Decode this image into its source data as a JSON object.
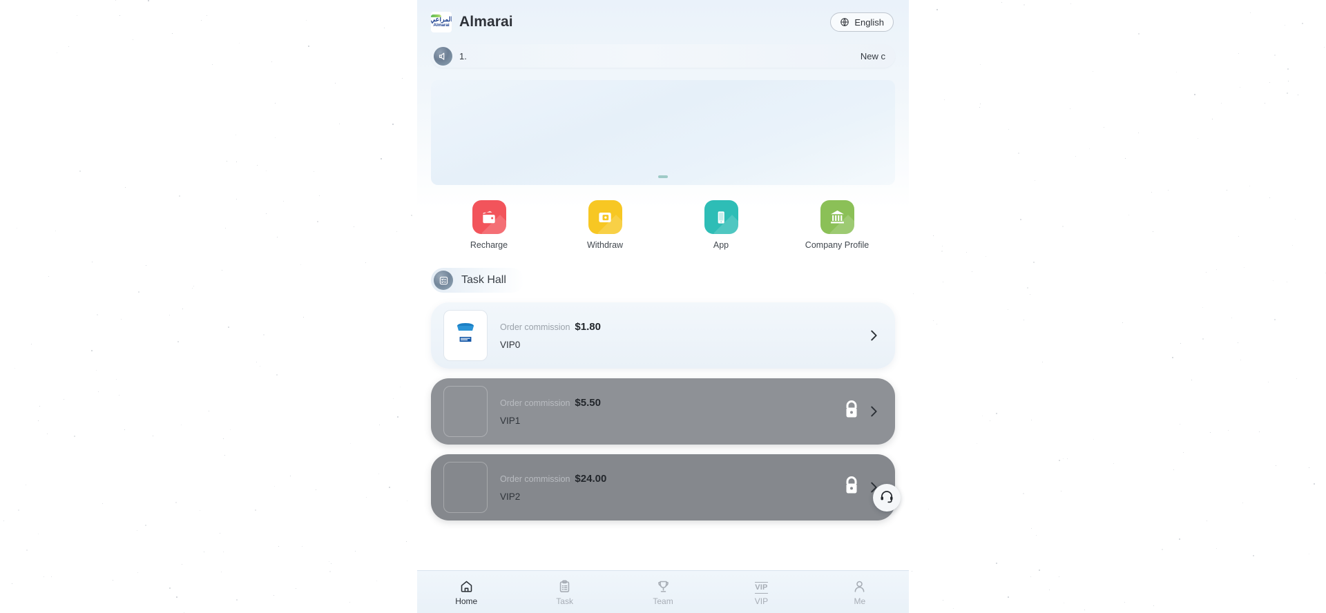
{
  "header": {
    "brand_name": "Almarai",
    "logo_arabic": "المراعي",
    "logo_latin": "Almarai",
    "language_label": "English",
    "language_icon": "globe-icon"
  },
  "notice": {
    "icon": "megaphone-icon",
    "index": "1.",
    "text": "New c"
  },
  "banner": {
    "dots": 1
  },
  "quick_actions": [
    {
      "label": "Recharge",
      "icon": "wallet-icon",
      "color": "#f2545b"
    },
    {
      "label": "Withdraw",
      "icon": "withdraw-card-icon",
      "color": "#f7c723"
    },
    {
      "label": "App",
      "icon": "mobile-app-icon",
      "color": "#2ebdb6"
    },
    {
      "label": "Company Profile",
      "icon": "bank-building-icon",
      "color": "#8bc057"
    }
  ],
  "task_hall": {
    "icon": "checklist-icon",
    "title": "Task Hall"
  },
  "vip_cards": [
    {
      "level": "VIP0",
      "commission_label": "Order commission",
      "commission_value": "$1.80",
      "locked": false,
      "thumb": "yogurt-tub-product-image",
      "chevron": "chevron-right-icon"
    },
    {
      "level": "VIP1",
      "commission_label": "Order commission",
      "commission_value": "$5.50",
      "locked": true,
      "lock_icon": "lock-icon",
      "chevron": "chevron-right-icon"
    },
    {
      "level": "VIP2",
      "commission_label": "Order commission",
      "commission_value": "$24.00",
      "locked": true,
      "lock_icon": "lock-icon",
      "chevron": "chevron-right-icon"
    }
  ],
  "support": {
    "icon": "headset-icon"
  },
  "bottom_nav": [
    {
      "label": "Home",
      "icon": "home-icon",
      "active": true
    },
    {
      "label": "Task",
      "icon": "clipboard-icon",
      "active": false
    },
    {
      "label": "Team",
      "icon": "trophy-icon",
      "active": false
    },
    {
      "label": "VIP",
      "icon": "vip-badge-icon",
      "active": false
    },
    {
      "label": "Me",
      "icon": "person-icon",
      "active": false
    }
  ],
  "colors": {
    "accent_blue": "#1b3f8f",
    "locked_gray": "#8e9196",
    "page_bg": "#ffffff"
  }
}
